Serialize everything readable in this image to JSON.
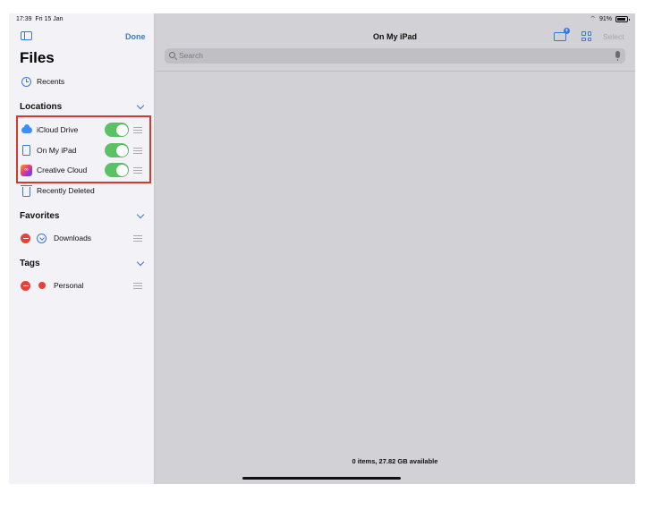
{
  "status_bar": {
    "time": "17:39",
    "date": "Fri 15 Jan",
    "battery": "91%"
  },
  "sidebar": {
    "done_label": "Done",
    "title": "Files",
    "recents_label": "Recents",
    "locations": {
      "heading": "Locations",
      "items": [
        {
          "label": "iCloud Drive",
          "enabled": true,
          "icon": "icloud-icon"
        },
        {
          "label": "On My iPad",
          "enabled": true,
          "icon": "ipad-icon"
        },
        {
          "label": "Creative Cloud",
          "enabled": true,
          "icon": "creative-cloud-icon"
        }
      ],
      "recently_deleted_label": "Recently Deleted"
    },
    "favorites": {
      "heading": "Favorites",
      "items": [
        {
          "label": "Downloads"
        }
      ]
    },
    "tags": {
      "heading": "Tags",
      "items": [
        {
          "label": "Personal",
          "color": "#e5403a"
        }
      ]
    }
  },
  "main": {
    "title": "On My iPad",
    "select_label": "Select",
    "search_placeholder": "Search",
    "footer": "0 items, 27.82 GB available"
  },
  "colors": {
    "accent": "#3a78d6",
    "toggle_on": "#5ac264",
    "delete_red": "#e5403a",
    "highlight_box": "#d03a2f"
  }
}
